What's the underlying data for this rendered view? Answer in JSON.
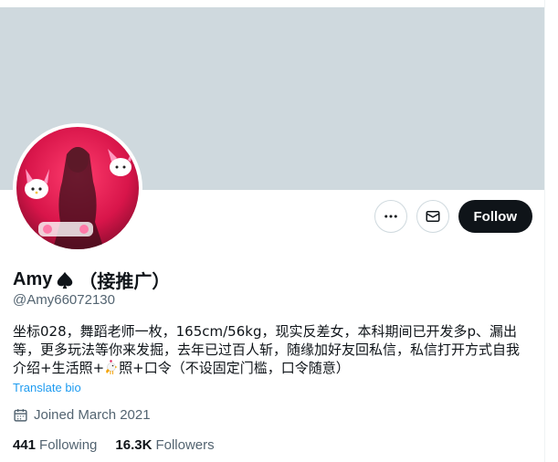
{
  "profile": {
    "name": "Amy",
    "name_suffix": "（接推广）",
    "handle": "@Amy66072130",
    "bio_lines": [
      "坐标028，舞蹈老师一枚，165cm/56kg，现实反差女，本科期间已开发多p、漏出",
      "等，更多玩法等你来发掘，去年已过百人斩，随缘加好友回私信，私信打开方式自我",
      "介绍+生活照+",
      "照+口令（不设固定门槛，口令随意）"
    ],
    "translate_label": "Translate bio",
    "joined": "Joined March 2021"
  },
  "actions": {
    "follow_label": "Follow"
  },
  "stats": {
    "following_count": "441",
    "following_label": "Following",
    "followers_count": "16.3K",
    "followers_label": "Followers"
  },
  "icons": {
    "more": "more-dots-icon",
    "message": "envelope-icon",
    "calendar": "calendar-icon",
    "spade": "spade-icon",
    "rooster": "rooster-icon"
  },
  "colors": {
    "banner": "#cfd9de",
    "follow_bg": "#0f1419",
    "link": "#1d9bf0",
    "secondary_text": "#536471"
  }
}
